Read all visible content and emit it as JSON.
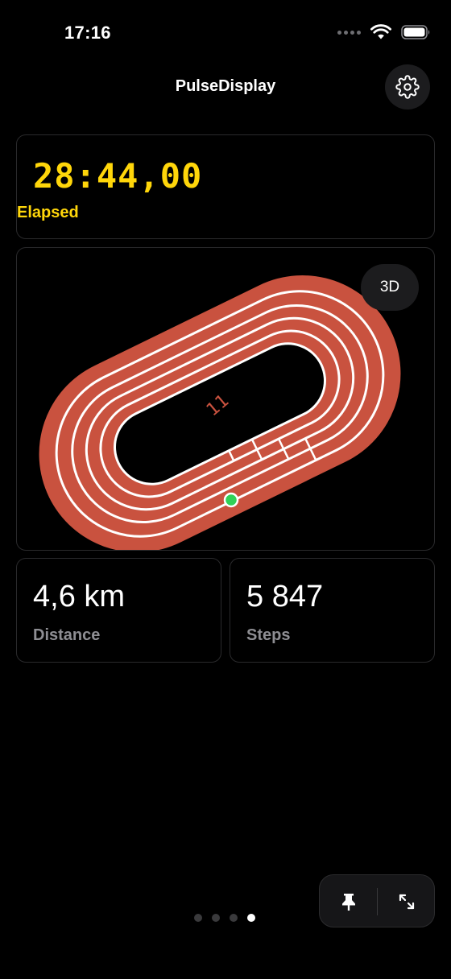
{
  "status_bar": {
    "time": "17:16"
  },
  "nav": {
    "title": "PulseDisplay"
  },
  "elapsed": {
    "value": "28:44,00",
    "label": "Elapsed"
  },
  "track": {
    "lane_marker": "11",
    "view_toggle_label": "3D",
    "track_color": "#c9523f"
  },
  "distance": {
    "value": "4,6 km",
    "label": "Distance"
  },
  "steps": {
    "value": "5 847",
    "label": "Steps"
  },
  "pager": {
    "total_pages": 4,
    "current_page": 4
  },
  "colors": {
    "accent": "#ffd60a",
    "position_marker": "#30d158",
    "muted": "#8e8e93"
  },
  "icons": {
    "settings": "gear-icon",
    "pin": "pin-icon",
    "fullscreen": "expand-icon"
  }
}
